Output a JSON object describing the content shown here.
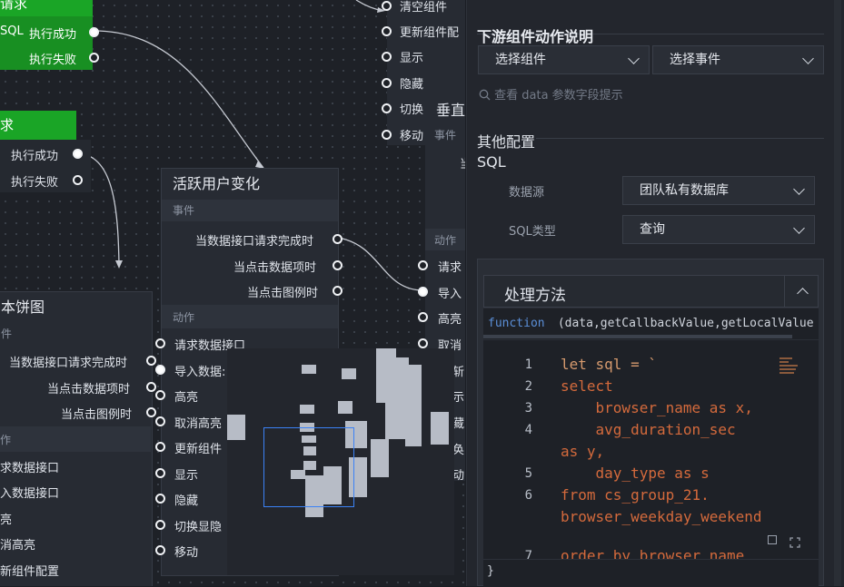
{
  "canvas": {
    "top_node_a": {
      "title": "请求",
      "rows": [
        "SQL",
        "执行成功",
        "执行失败"
      ]
    },
    "top_node_b": {
      "title": "求",
      "rows": [
        "执行成功",
        "执行失败"
      ]
    },
    "middle_node": {
      "title": "活跃用户变化",
      "event_section": "事件",
      "events": [
        "当数据接口请求完成时",
        "当点击数据项时",
        "当点击图例时"
      ],
      "action_section": "动作",
      "actions": [
        "请求数据接口",
        "导入数据:",
        "高亮",
        "取消高亮",
        "更新组件",
        "显示",
        "隐藏",
        "切换显隐",
        "移动"
      ]
    },
    "left_node": {
      "title": "本饼图",
      "event_section": "件",
      "events": [
        "当数据接口请求完成时",
        "当点击数据项时",
        "当点击图例时"
      ],
      "action_section": "作",
      "actions": [
        "求数据接口",
        "入数据接口",
        "亮",
        "消高亮",
        "新组件配置"
      ]
    },
    "top_right_node": {
      "actions": [
        "清空组件",
        "更新组件配",
        "显示",
        "隐藏",
        "切换",
        "移动"
      ]
    },
    "vertical_node": {
      "title": "垂直",
      "event_section": "事件",
      "event_cut": "当",
      "action_section": "动作",
      "actions": [
        "请求",
        "导入",
        "高亮",
        "取消",
        "斩",
        "示",
        "藏",
        "奂",
        "动"
      ]
    }
  },
  "panel": {
    "section_title": "下游组件动作说明",
    "select_component": "选择组件",
    "select_event": "选择事件",
    "search_hint": "查看 data 参数字段提示",
    "other_config": "其他配置",
    "sql_label": "SQL",
    "datasource_label": "数据源",
    "datasource_value": "团队私有数据库",
    "sqltype_label": "SQL类型",
    "sqltype_value": "查询",
    "method_title": "处理方法",
    "function_kw": "function",
    "function_sig": " (data,getCallbackValue,getLocalValue",
    "closing_brace": "}",
    "code_line_numbers": [
      "1",
      "2",
      "3",
      "4",
      "5",
      "6",
      "7"
    ],
    "code_lines": [
      "let sql = `",
      "select",
      "    browser_name as x,",
      "    avg_duration_sec",
      "as y,",
      "    day_type as s",
      "from cs_group_21.",
      "browser_weekday_weekend",
      "order by browser_name"
    ]
  }
}
